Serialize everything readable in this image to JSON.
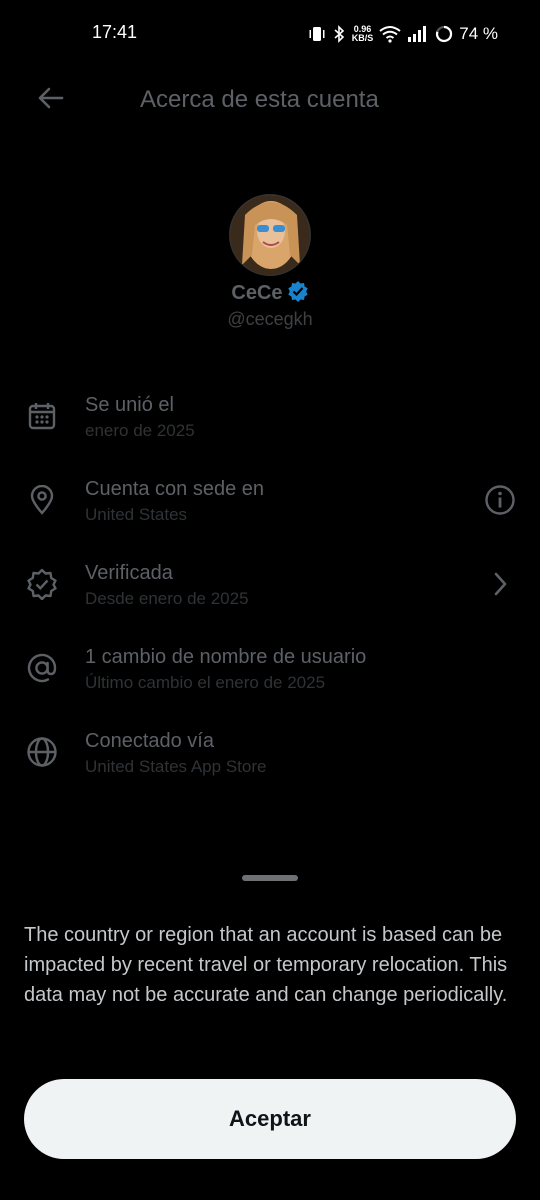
{
  "status_bar": {
    "time": "17:41",
    "net_speed_value": "0.96",
    "net_speed_unit": "KB/S",
    "battery": "74 %",
    "icons": [
      "vibrate-icon",
      "bluetooth-icon",
      "wifi-icon",
      "signal-icon",
      "battery-ring-icon"
    ]
  },
  "header": {
    "title": "Acerca de esta cuenta",
    "back_icon": "arrow-left-icon"
  },
  "profile": {
    "name": "CeCe",
    "handle": "@cecegkh",
    "verified_badge_color": "#1d9bf0"
  },
  "rows": [
    {
      "icon": "calendar-icon",
      "title": "Se unió el",
      "subtitle": "enero de 2025"
    },
    {
      "icon": "location-pin-icon",
      "title": "Cuenta con sede en",
      "subtitle": "United States",
      "trailing": "info-icon"
    },
    {
      "icon": "verified-badge-icon",
      "title": "Verificada",
      "subtitle": "Desde enero de 2025",
      "trailing": "chevron-right-icon"
    },
    {
      "icon": "at-sign-icon",
      "title": "1 cambio de nombre de usuario",
      "subtitle": "Último cambio el enero de 2025"
    },
    {
      "icon": "globe-icon",
      "title": "Conectado vía",
      "subtitle": "United States App Store"
    }
  ],
  "sheet": {
    "disclaimer": "The country or region that an account is based can be impacted by recent travel or temporary relocation. This data may not be accurate and can change periodically.",
    "accept_label": "Aceptar"
  },
  "colors": {
    "background": "#000000",
    "dimmed_text": "#5d6166",
    "button_bg": "#eff3f4",
    "button_text": "#0f1419"
  }
}
